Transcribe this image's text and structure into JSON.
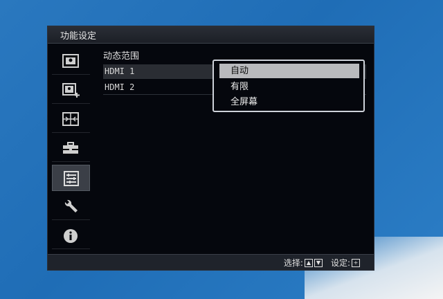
{
  "osd": {
    "title": "功能设定",
    "sidebar": [
      {
        "icon": "picture-icon"
      },
      {
        "icon": "picture-add-icon"
      },
      {
        "icon": "screen-layout-icon"
      },
      {
        "icon": "toolbox-icon"
      },
      {
        "icon": "function-list-icon"
      },
      {
        "icon": "wrench-icon"
      },
      {
        "icon": "info-icon"
      }
    ],
    "content": {
      "header": "动态范围",
      "rows": [
        {
          "label": "HDMI 1"
        },
        {
          "label": "HDMI 2"
        }
      ]
    },
    "popup": {
      "options": [
        "自动",
        "有限",
        "全屏幕"
      ],
      "selected": "自动"
    },
    "footer": {
      "select_label": "选择:",
      "set_label": "设定:"
    }
  },
  "colors": {
    "desktop_bg": "#1f6db6",
    "osd_bg": "#05070d",
    "selection_bg": "#b9babd"
  }
}
